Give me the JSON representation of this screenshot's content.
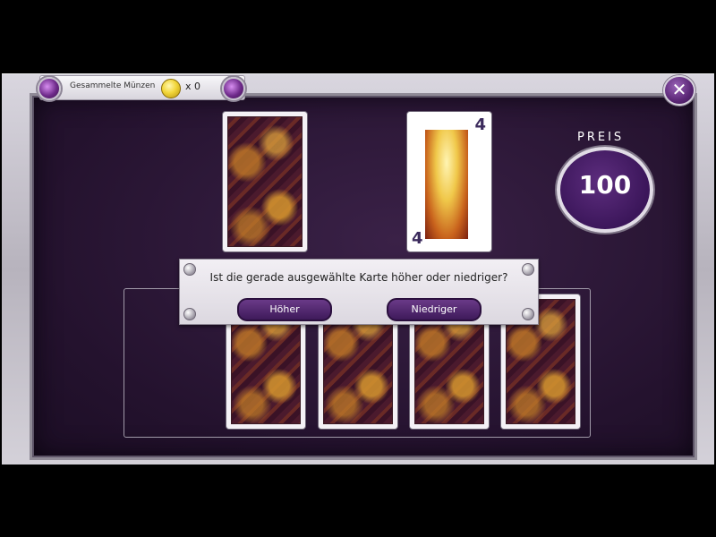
{
  "header": {
    "coins_label": "Gesammelte Münzen",
    "coins_count": "x 0",
    "close_icon": "close-icon",
    "close_symbol": "✕"
  },
  "prize": {
    "label": "PREIS",
    "value": "100"
  },
  "revealed_card": {
    "rank_top": "4",
    "rank_bottom": "4",
    "image": "dragon-art"
  },
  "dialog": {
    "question": "Ist die gerade ausgewählte Karte höher oder niedriger?",
    "higher_label": "Höher",
    "lower_label": "Niedriger"
  },
  "colors": {
    "felt": "#24122e",
    "accent_purple": "#5a2675",
    "frame": "#c9c6cf"
  }
}
